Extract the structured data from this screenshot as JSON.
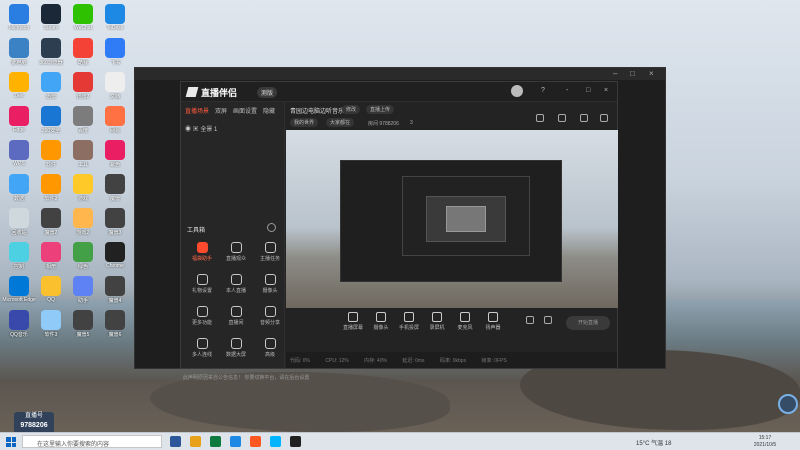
{
  "desktop_icons": [
    {
      "label": "Microsoft",
      "color": "#2a7de1"
    },
    {
      "label": "Steam",
      "color": "#1b2838"
    },
    {
      "label": "WeChat",
      "color": "#2dc100"
    },
    {
      "label": "ToDesk",
      "color": "#1e88e5"
    },
    {
      "label": "此电脑",
      "color": "#3b82c4"
    },
    {
      "label": "360浏览器",
      "color": "#2c3e50"
    },
    {
      "label": "酷我",
      "color": "#f44336"
    },
    {
      "label": "飞书",
      "color": "#2f7cf6"
    },
    {
      "label": "Dev",
      "color": "#ffb300"
    },
    {
      "label": "迅雷",
      "color": "#42a5f5"
    },
    {
      "label": "迅雷2",
      "color": "#e53935"
    },
    {
      "label": "文档",
      "color": "#eeeeee"
    },
    {
      "label": "Edge",
      "color": "#e91e63"
    },
    {
      "label": "360安全",
      "color": "#1976d2"
    },
    {
      "label": "百度",
      "color": "#7c7c7c"
    },
    {
      "label": "网易",
      "color": "#ff7043"
    },
    {
      "label": "WPS",
      "color": "#5c6bc0"
    },
    {
      "label": "软件",
      "color": "#ff9800"
    },
    {
      "label": "工具",
      "color": "#8d6e63"
    },
    {
      "label": "紫色",
      "color": "#e91e63"
    },
    {
      "label": "数据",
      "color": "#42a5f5"
    },
    {
      "label": "软件2",
      "color": "#ff9800"
    },
    {
      "label": "游戏",
      "color": "#ffca28"
    },
    {
      "label": "魔兽",
      "color": "#424242"
    },
    {
      "label": "回收站",
      "color": "#cfd8dc"
    },
    {
      "label": "魔兽2",
      "color": "#424242"
    },
    {
      "label": "游戏2",
      "color": "#ffb74d"
    },
    {
      "label": "魔兽3",
      "color": "#424242"
    },
    {
      "label": "控制",
      "color": "#4dd0e1"
    },
    {
      "label": "相册",
      "color": "#ec407a"
    },
    {
      "label": "绿色",
      "color": "#43a047"
    },
    {
      "label": "Chrome",
      "color": "#212121"
    },
    {
      "label": "Microsoft Edge",
      "color": "#0078d7"
    },
    {
      "label": "QQ",
      "color": "#fbc02d"
    },
    {
      "label": "助手",
      "color": "#5e81f4"
    },
    {
      "label": "魔兽4",
      "color": "#424242"
    },
    {
      "label": "QQ音乐",
      "color": "#3949ab"
    },
    {
      "label": "软件3",
      "color": "#90caf9"
    },
    {
      "label": "魔兽5",
      "color": "#424242"
    },
    {
      "label": "魔兽6",
      "color": "#424242"
    }
  ],
  "app": {
    "logo": "直播伴侣",
    "badge": "测版",
    "window_controls": [
      "?",
      "-",
      "□",
      "×"
    ],
    "left_tabs": [
      "直播场景",
      "双屏",
      "画面设置",
      "隐藏"
    ],
    "scene_label": "全景 1",
    "tools_title": "工具箱",
    "tools": [
      {
        "label": "福袋助手",
        "red": true
      },
      {
        "label": "直播观众",
        "red": false
      },
      {
        "label": "主播任务",
        "red": false
      },
      {
        "label": "礼物设置",
        "red": false
      },
      {
        "label": "本人直播",
        "red": false
      },
      {
        "label": "摄像头",
        "red": false
      },
      {
        "label": "更多功能",
        "red": false
      },
      {
        "label": "直播间",
        "red": false
      },
      {
        "label": "音频分享",
        "red": false
      },
      {
        "label": "多人连线",
        "red": false
      },
      {
        "label": "数据大屏",
        "red": false
      },
      {
        "label": "高级",
        "red": false
      }
    ],
    "left_footer": "此声明原因来自公告信息！ 你要切换平台，请在后台设置",
    "room_title": "青园边电脑边听音乐",
    "chip_change": "修改",
    "chip_upload": "直播上传",
    "chip_game": "我的世界",
    "chip_category": "大家都在",
    "room_id": "房间 9788206",
    "room_count": "3",
    "bottom_actions": [
      "直播屏幕",
      "摄像头",
      "手机投屏",
      "录屏机",
      "麦克风",
      "扬声器"
    ],
    "start_live": "开始直播",
    "status_items": [
      "代码: 0%",
      "CPU: 12%",
      "内存: 40%",
      "延迟: 0ms",
      "码率: 0kbps",
      "帧率: 0FPS"
    ]
  },
  "watermark": {
    "line1": "直播号",
    "line2": "9788206"
  },
  "taskbar": {
    "search_placeholder": "在这里输入你要搜索的内容",
    "apps": [
      "#2b579a",
      "#e8a21a",
      "#0f7a3f",
      "#1e88e5",
      "#ff5722",
      "#00b4ff",
      "#212121"
    ],
    "weather": "15°C 气温 18",
    "time": "15:17",
    "date": "2021/10/5"
  }
}
